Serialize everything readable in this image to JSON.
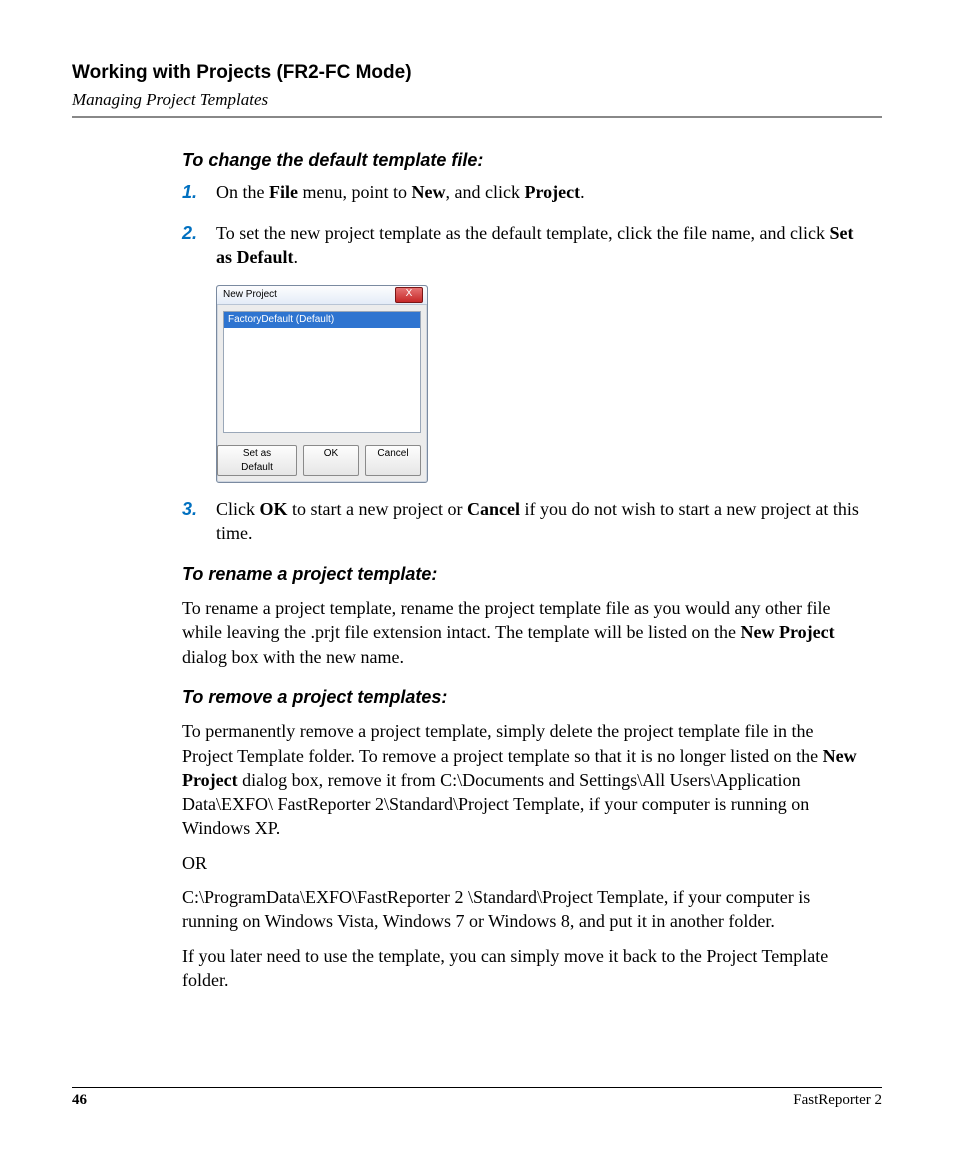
{
  "header": {
    "chapter": "Working with Projects (FR2-FC Mode)",
    "section": "Managing Project Templates"
  },
  "sections": {
    "change_default": {
      "heading": "To change the default template file:",
      "step1_pre": "On the ",
      "step1_b1": "File",
      "step1_mid": " menu, point to ",
      "step1_b2": "New",
      "step1_mid2": ", and click ",
      "step1_b3": "Project",
      "step1_end": ".",
      "step2_pre": "To set the new project template as the default template, click the file name, and click ",
      "step2_b": "Set as Default",
      "step2_end": ".",
      "step3_pre": "Click ",
      "step3_b1": "OK",
      "step3_mid": " to start a new project or ",
      "step3_b2": "Cancel",
      "step3_end": " if you do not wish to start a new project at this time."
    },
    "rename": {
      "heading": "To rename a project template:",
      "p_pre": "To rename a project template, rename the project template file as you would any other file while leaving the .prjt file extension intact. The template will be listed on the ",
      "p_b": "New Project",
      "p_end": " dialog box with the new name."
    },
    "remove": {
      "heading": "To remove a project templates:",
      "p1_pre": "To permanently remove a project template, simply delete the project template file in the Project Template folder. To remove a project template so that it is no longer listed on the ",
      "p1_b": "New Project",
      "p1_end": " dialog box, remove it from C:\\Documents and Settings\\All Users\\Application Data\\EXFO\\ FastReporter 2\\Standard\\Project Template, if your computer is running on Windows XP.",
      "or": "OR",
      "p2": "C:\\ProgramData\\EXFO\\FastReporter  2 \\Standard\\Project Template, if your computer is running on Windows Vista, Windows 7 or Windows 8, and put it in another folder.",
      "p3": "If you later need to use the template, you can simply move it back to the Project Template folder."
    }
  },
  "dialog": {
    "title": "New Project",
    "close": "X",
    "selected_item": "FactoryDefault (Default)",
    "buttons": {
      "set_default": "Set as Default",
      "ok": "OK",
      "cancel": "Cancel"
    }
  },
  "nums": {
    "n1": "1.",
    "n2": "2.",
    "n3": "3."
  },
  "footer": {
    "page": "46",
    "product": "FastReporter 2"
  }
}
